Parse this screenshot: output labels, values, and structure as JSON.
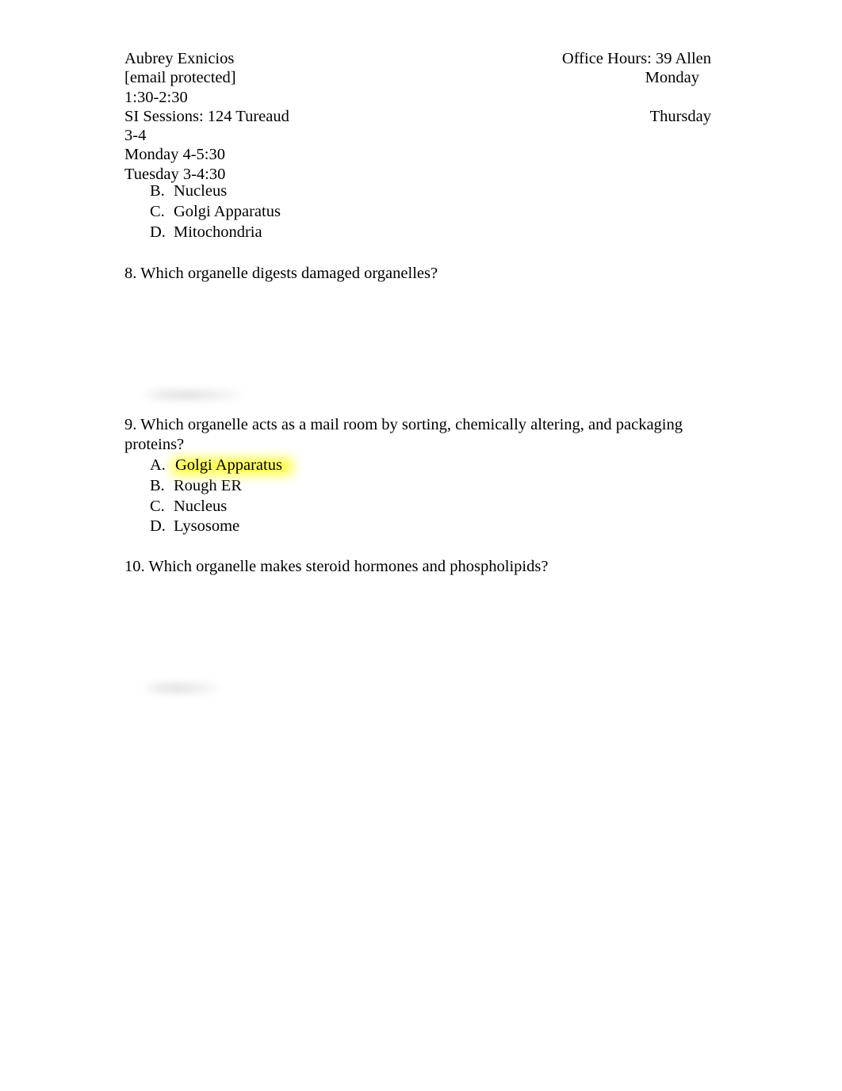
{
  "document": {
    "page_background": "#ffffff",
    "text_color": "#000000",
    "highlight_color": "#ffff33"
  },
  "header": {
    "rows": [
      {
        "left": "Aubrey Exnicios",
        "right": "Office Hours: 39 Allen"
      },
      {
        "left": "[email protected]",
        "right": "Monday"
      },
      {
        "left": "1:30-2:30",
        "right": ""
      },
      {
        "left": "SI Sessions: 124 Tureaud",
        "right": "Thursday"
      },
      {
        "left": "3-4",
        "right": ""
      },
      {
        "left": "Monday 4-5:30",
        "right": ""
      },
      {
        "left": "Tuesday 3-4:30",
        "right": ""
      }
    ]
  },
  "content": {
    "question7_options": [
      {
        "letter": "B.",
        "text": "Nucleus",
        "highlighted": false
      },
      {
        "letter": "C.",
        "text": "Golgi Apparatus",
        "highlighted": false
      },
      {
        "letter": "D.",
        "text": "Mitochondria",
        "highlighted": false
      }
    ],
    "question8": {
      "text": "8. Which organelle digests damaged organelles?"
    },
    "question9": {
      "text": "9. Which organelle acts as a mail room by sorting, chemically altering, and packaging proteins?",
      "options": [
        {
          "letter": "A.",
          "text": "Golgi Apparatus",
          "highlighted": true
        },
        {
          "letter": "B.",
          "text": "Rough ER",
          "highlighted": false
        },
        {
          "letter": "C.",
          "text": "Nucleus",
          "highlighted": false
        },
        {
          "letter": "D.",
          "text": "Lysosome",
          "highlighted": false
        }
      ]
    },
    "question10": {
      "text": "10.  Which organelle makes steroid hormones and phospholipids?"
    }
  },
  "artifacts": {
    "smudges": [
      {
        "name": "blurred-text-artifact-1"
      },
      {
        "name": "blurred-text-artifact-2"
      }
    ]
  }
}
